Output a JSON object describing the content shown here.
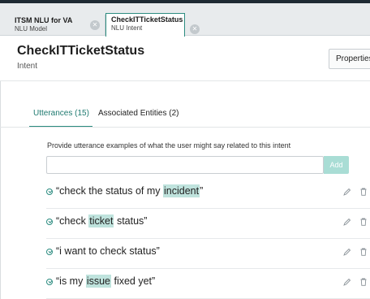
{
  "tabs": [
    {
      "title": "ITSM NLU for VA",
      "subtitle": "NLU Model"
    },
    {
      "title": "CheckITTicketStatus",
      "subtitle": "NLU Intent"
    }
  ],
  "header": {
    "title": "CheckITTicketStatus",
    "subtitle": "Intent",
    "properties_label": "Properties"
  },
  "sub_tabs": {
    "utterances": "Utterances (15)",
    "entities": "Associated Entities (2)"
  },
  "utterance_form": {
    "hint": "Provide utterance examples of what the user might say related to this intent",
    "input_value": "",
    "add_label": "Add"
  },
  "utterances": [
    {
      "before": "“check the status of my ",
      "highlight": "incident",
      "after": "”"
    },
    {
      "before": "“check ",
      "highlight": "ticket",
      "after": " status”"
    },
    {
      "before": "“i want to check status”",
      "highlight": "",
      "after": ""
    },
    {
      "before": "“is my ",
      "highlight": "issue",
      "after": " fixed yet”"
    }
  ],
  "colors": {
    "accent": "#2c8c80",
    "highlight": "#bfe3dd",
    "add_button": "#a9ddd5"
  }
}
